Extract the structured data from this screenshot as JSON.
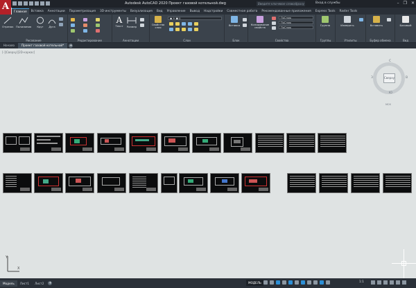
{
  "window": {
    "title": "Autodesk AutoCAD 2020    Проект газовой котельной.dwg",
    "search_placeholder": "Введите ключевое слово/фразу",
    "login_label": "Вход в службы",
    "logo_letter": "A"
  },
  "ribbon_tabs": [
    "Главная",
    "Вставка",
    "Аннотации",
    "Параметризация",
    "3D-инструменты",
    "Визуализация",
    "Вид",
    "Управление",
    "Вывод",
    "Надстройки",
    "Совместная работа",
    "Рекомендованные приложения",
    "Express Tools",
    "Raster Tools"
  ],
  "active_ribbon_tab": "Главная",
  "ribbon": {
    "draw": {
      "label": "Рисование",
      "tools": [
        "Отрезок",
        "Полилиния",
        "Круг",
        "Дуга"
      ]
    },
    "modify": {
      "label": "Редактирование"
    },
    "annotation": {
      "label": "Аннотации",
      "tools": [
        "Текст",
        "Размер"
      ]
    },
    "layers": {
      "label": "Слои",
      "tool": "Свойства слоя"
    },
    "block": {
      "label": "Блок",
      "tool": "Вставка"
    },
    "properties": {
      "label": "Свойства",
      "tool": "Копирование свойств",
      "bylayer1": "ПоСлою",
      "bylayer2": "ПоСлою",
      "bylayer3": "ПоСлою"
    },
    "groups": {
      "label": "Группы",
      "tool": "Группа"
    },
    "utilities": {
      "label": "Утилиты",
      "tool": "Измерить"
    },
    "clipboard": {
      "label": "Буфер обмена",
      "tool": "Вставить"
    },
    "view": {
      "label": "Вид",
      "tool": "Базовый"
    }
  },
  "doc_tabs": [
    "Начало",
    "Проект газовой котельной*"
  ],
  "viewport_label": "[-][Сверху][2D-каркас]",
  "viewcube": {
    "top": "Сверху",
    "north": "С",
    "south": "Ю",
    "west": "З",
    "east": "В",
    "ucs": "МСК"
  },
  "layout_tabs": [
    "Модель",
    "Лист1",
    "Лист2"
  ],
  "status": {
    "model": "МОДЕЛЬ",
    "scale": "1:1"
  },
  "ucs_labels": {
    "x": "X",
    "y": "Y"
  }
}
